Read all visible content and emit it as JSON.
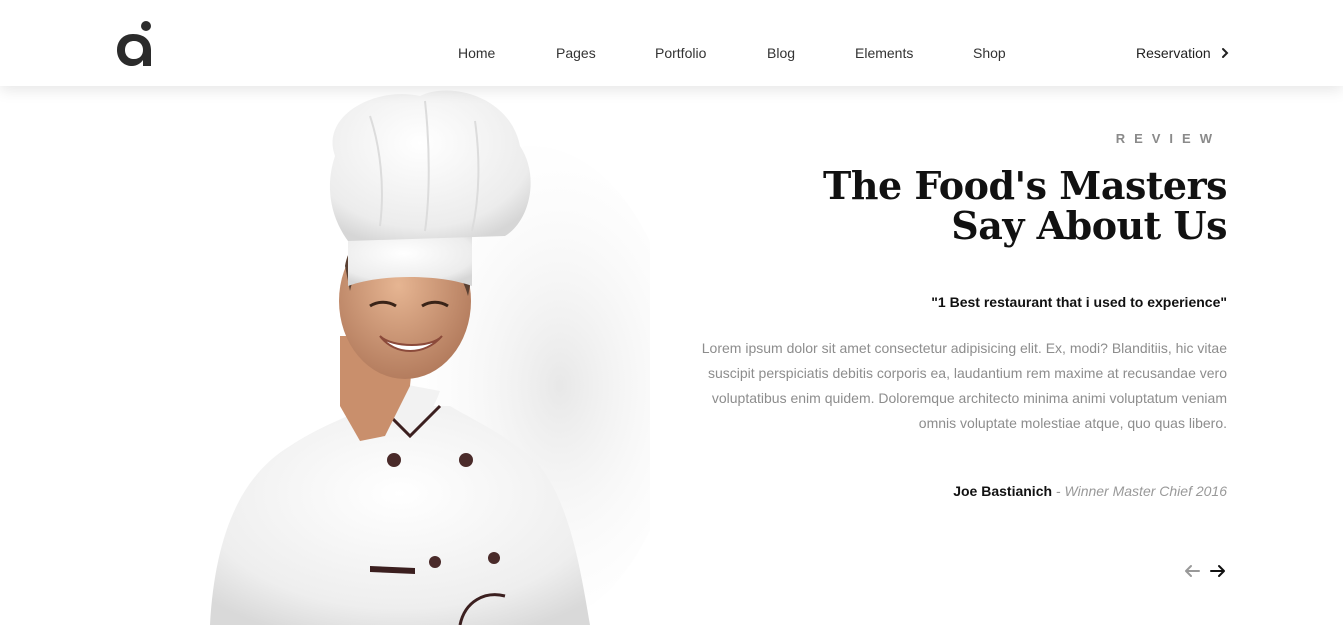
{
  "header": {
    "logo_icon": "brand-logo-icon",
    "nav": [
      "Home",
      "Pages",
      "Portfolio",
      "Blog",
      "Elements",
      "Shop"
    ],
    "reservation_label": "Reservation",
    "reservation_icon": "chevron-right-icon"
  },
  "hero": {
    "image": "chef-portrait",
    "kicker": "REVIEW",
    "title_line1": "The Food's Masters",
    "title_line2": "Say About Us",
    "quote": "\"1 Best restaurant that i used to experience\"",
    "body": "Lorem ipsum dolor sit amet consectetur adipisicing elit. Ex, modi? Blanditiis, hic vitae suscipit perspiciatis debitis corporis ea, laudantium rem maxime at recusandae vero voluptatibus enim quidem. Doloremque architecto minima animi voluptatum veniam omnis voluptate molestiae atque, quo quas libero.",
    "author_name": "Joe Bastianich",
    "author_role": " - Winner Master Chief 2016",
    "prev_icon": "arrow-left-icon",
    "next_icon": "arrow-right-icon"
  },
  "colors": {
    "text_dark": "#111111",
    "text_muted": "#8d8d8d",
    "kicker": "#8a8a8a"
  }
}
